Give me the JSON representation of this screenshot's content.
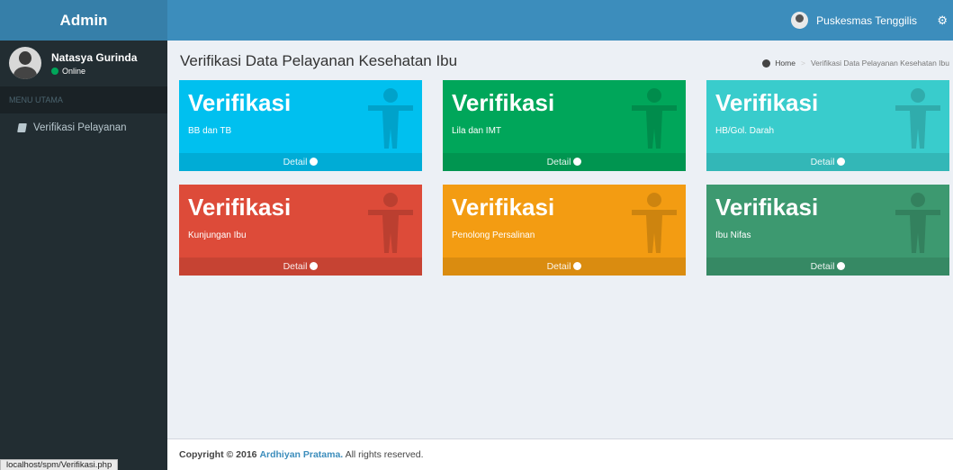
{
  "app": {
    "title": "Admin"
  },
  "header": {
    "user_label": "Puskesmas Tenggilis"
  },
  "sidebar": {
    "user_name": "Natasya Gurinda",
    "status": "Online",
    "menu_header": "MENU UTAMA",
    "items": [
      {
        "label": "Verifikasi Pelayanan"
      }
    ]
  },
  "page": {
    "title": "Verifikasi Data Pelayanan Kesehatan Ibu",
    "breadcrumb": {
      "home": "Home",
      "current": "Verifikasi Data Pelayanan Kesehatan Ibu"
    }
  },
  "boxes": [
    {
      "heading": "Verifikasi",
      "sub": "BB dan TB",
      "footer": "Detail",
      "color": "#00c0ef"
    },
    {
      "heading": "Verifikasi",
      "sub": "Lila dan IMT",
      "footer": "Detail",
      "color": "#00a65a"
    },
    {
      "heading": "Verifikasi",
      "sub": "HB/Gol. Darah",
      "footer": "Detail",
      "color": "#39cccc"
    },
    {
      "heading": "Verifikasi",
      "sub": "Kunjungan Ibu",
      "footer": "Detail",
      "color": "#dd4b39"
    },
    {
      "heading": "Verifikasi",
      "sub": "Penolong Persalinan",
      "footer": "Detail",
      "color": "#f39c12"
    },
    {
      "heading": "Verifikasi",
      "sub": "Ibu Nifas",
      "footer": "Detail",
      "color": "#3d9970"
    }
  ],
  "footer": {
    "prefix": "Copyright © 2016",
    "author": "Ardhiyan Pratama.",
    "suffix": "All rights reserved."
  },
  "status_bar": {
    "url": "localhost/spm/Verifikasi.php"
  }
}
